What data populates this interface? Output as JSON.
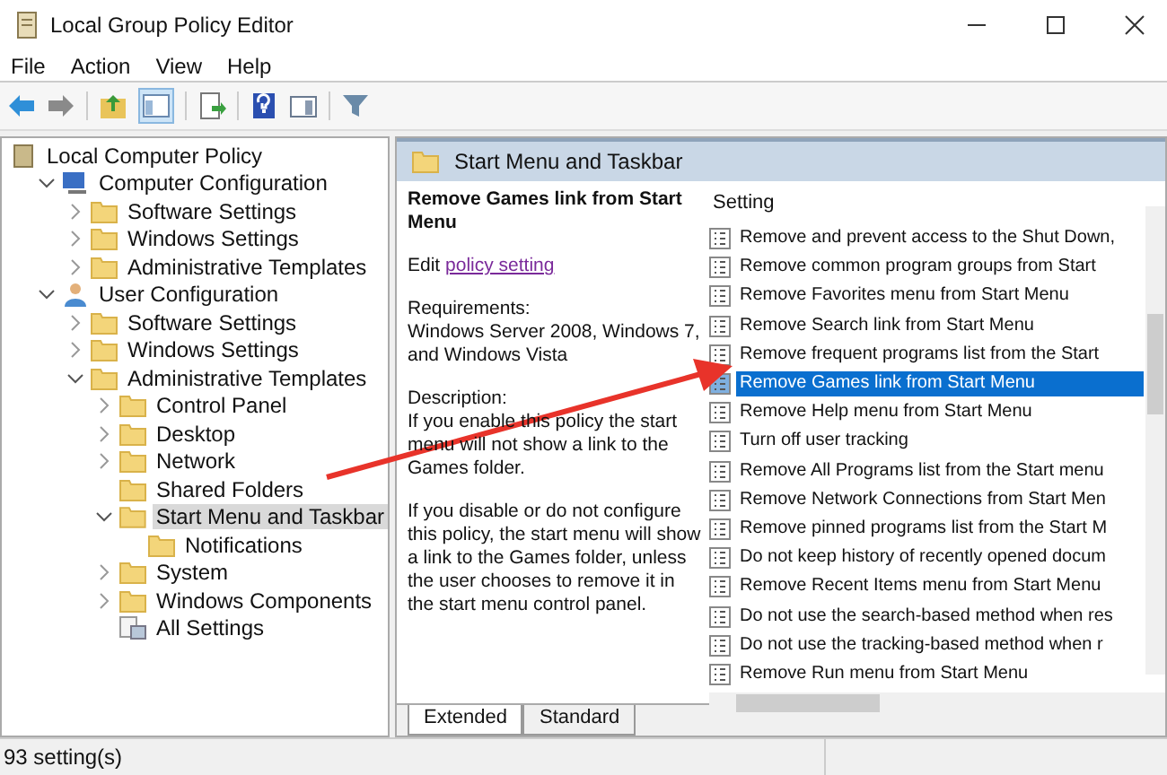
{
  "window": {
    "title": "Local Group Policy Editor"
  },
  "menu": [
    "File",
    "Action",
    "View",
    "Help"
  ],
  "tree": [
    {
      "label": "Local Computer Policy",
      "kind": "policy",
      "selected": false,
      "children": [
        {
          "label": "Computer Configuration",
          "kind": "computer",
          "expanded": true,
          "selected": false,
          "children": [
            {
              "label": "Software Settings",
              "kind": "folder",
              "expanded": false,
              "selected": false
            },
            {
              "label": "Windows Settings",
              "kind": "folder",
              "expanded": false,
              "selected": false
            },
            {
              "label": "Administrative Templates",
              "kind": "folder",
              "expanded": false,
              "selected": false
            }
          ]
        },
        {
          "label": "User Configuration",
          "kind": "user",
          "expanded": true,
          "selected": false,
          "children": [
            {
              "label": "Software Settings",
              "kind": "folder",
              "expanded": false,
              "selected": false
            },
            {
              "label": "Windows Settings",
              "kind": "folder",
              "expanded": false,
              "selected": false
            },
            {
              "label": "Administrative Templates",
              "kind": "folder",
              "expanded": true,
              "selected": false,
              "children": [
                {
                  "label": "Control Panel",
                  "kind": "folder",
                  "expanded": false,
                  "selected": false
                },
                {
                  "label": "Desktop",
                  "kind": "folder",
                  "expanded": false,
                  "selected": false
                },
                {
                  "label": "Network",
                  "kind": "folder",
                  "expanded": false,
                  "selected": false
                },
                {
                  "label": "Shared Folders",
                  "kind": "folder",
                  "selected": false
                },
                {
                  "label": "Start Menu and Taskbar",
                  "kind": "folder",
                  "expanded": true,
                  "selected": true,
                  "children": [
                    {
                      "label": "Notifications",
                      "kind": "folder",
                      "selected": false
                    }
                  ]
                },
                {
                  "label": "System",
                  "kind": "folder",
                  "expanded": false,
                  "selected": false
                },
                {
                  "label": "Windows Components",
                  "kind": "folder",
                  "expanded": false,
                  "selected": false
                },
                {
                  "label": "All Settings",
                  "kind": "settings",
                  "selected": false
                }
              ]
            }
          ]
        }
      ]
    }
  ],
  "header": {
    "title": "Start Menu and Taskbar"
  },
  "description": {
    "title": "Remove Games link from Start Menu",
    "edit_prefix": "Edit",
    "edit_link": "policy setting",
    "requirements_label": "Requirements:",
    "requirements": "Windows Server 2008, Windows 7, and Windows Vista",
    "description_label": "Description:",
    "paragraphs": [
      "If you enable this policy the start menu will not show a link to the Games folder.",
      "If you disable or do not configure this policy, the start menu will show a link to the Games folder, unless the user chooses to remove it in the start menu control panel."
    ]
  },
  "settings": {
    "column": "Setting",
    "rows": [
      {
        "label": "Remove and prevent access to the Shut Down,",
        "selected": false
      },
      {
        "label": "Remove common program groups from Start",
        "selected": false
      },
      {
        "label": "Remove Favorites menu from Start Menu",
        "selected": false
      },
      {
        "label": "Remove Search link from Start Menu",
        "selected": false
      },
      {
        "label": "Remove frequent programs list from the Start",
        "selected": false
      },
      {
        "label": "Remove Games link from Start Menu",
        "selected": true
      },
      {
        "label": "Remove Help menu from Start Menu",
        "selected": false
      },
      {
        "label": "Turn off user tracking",
        "selected": false
      },
      {
        "label": "Remove All Programs list from the Start menu",
        "selected": false
      },
      {
        "label": "Remove Network Connections from Start Men",
        "selected": false
      },
      {
        "label": "Remove pinned programs list from the Start M",
        "selected": false
      },
      {
        "label": "Do not keep history of recently opened docum",
        "selected": false
      },
      {
        "label": "Remove Recent Items menu from Start Menu",
        "selected": false
      },
      {
        "label": "Do not use the search-based method when res",
        "selected": false
      },
      {
        "label": "Do not use the tracking-based method when r",
        "selected": false
      },
      {
        "label": "Remove Run menu from Start Menu",
        "selected": false
      }
    ]
  },
  "tabs": [
    {
      "label": "Extended",
      "selected": true
    },
    {
      "label": "Standard",
      "selected": false
    }
  ],
  "status_bar": "93 setting(s)"
}
